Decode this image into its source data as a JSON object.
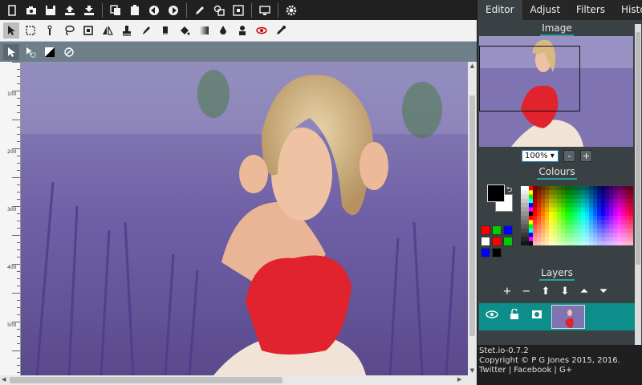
{
  "toolbar_main": {
    "buttons": [
      "new-icon",
      "camera-icon",
      "save-icon",
      "upload-icon",
      "download-icon",
      "copy-icon",
      "paste-icon",
      "undo-icon",
      "redo-icon",
      "pencil-icon",
      "shapes-icon",
      "crop-icon",
      "monitor-icon",
      "gear-icon"
    ]
  },
  "tabs": [
    "Editor",
    "Adjust",
    "Filters",
    "History"
  ],
  "image_section": {
    "title": "Image"
  },
  "zoom": {
    "value": "100%",
    "minus": "-",
    "plus": "+"
  },
  "colours_section": {
    "title": "Colours",
    "foreground": "#000000",
    "background": "#ffffff",
    "swatches": [
      "#ff0000",
      "#00cc00",
      "#0000ff",
      "#ffffff",
      "#ff0000",
      "#00cc00",
      "#0000ff",
      "#000000"
    ]
  },
  "layers_section": {
    "title": "Layers",
    "tools": [
      "+",
      "−",
      "⬆",
      "⬇",
      "⏶",
      "⏷"
    ]
  },
  "ruler": {
    "labels": [
      "100",
      "200",
      "300",
      "400",
      "500"
    ]
  },
  "footer": {
    "version": "Stet.io-0.7.2",
    "copyright": "Copyright © P G Jones 2015, 2016.",
    "link_twitter": "Twitter",
    "sep1": " | ",
    "link_facebook": "Facebook",
    "sep2": " | ",
    "link_gplus": "G+"
  },
  "colors": {
    "accent": "#2aa198",
    "layer_active": "#0e8e8a",
    "panel": "#3a4145"
  }
}
